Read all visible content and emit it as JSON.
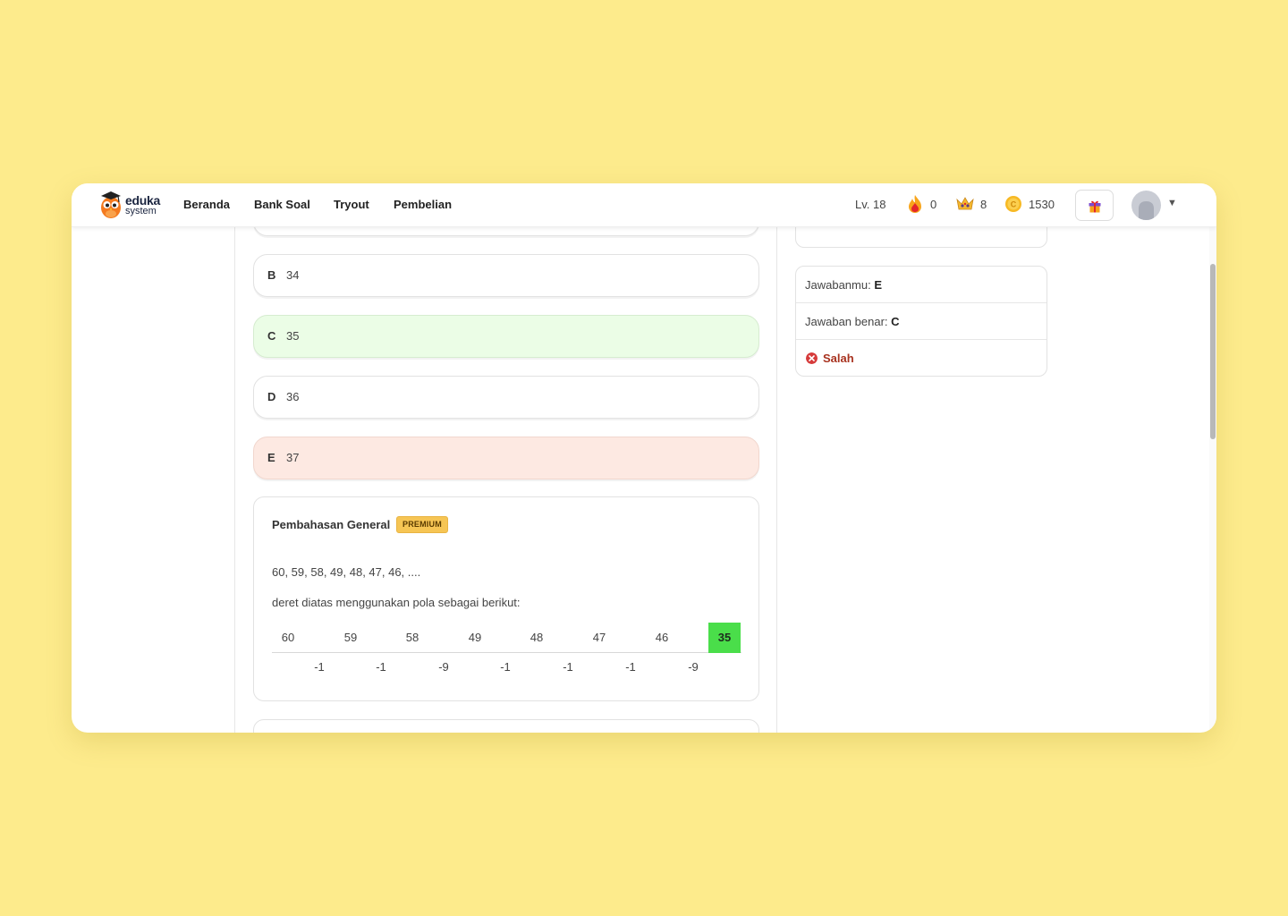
{
  "brand": {
    "name_line1": "eduka",
    "name_line2": "system"
  },
  "nav": {
    "links": [
      "Beranda",
      "Bank Soal",
      "Tryout",
      "Pembelian"
    ],
    "level": "Lv. 18",
    "streak": "0",
    "crowns": "8",
    "coins": "1530"
  },
  "options": [
    {
      "letter": "B",
      "value": "34",
      "state": "normal"
    },
    {
      "letter": "C",
      "value": "35",
      "state": "correct"
    },
    {
      "letter": "D",
      "value": "36",
      "state": "normal"
    },
    {
      "letter": "E",
      "value": "37",
      "state": "wrong"
    }
  ],
  "explanation": {
    "title": "Pembahasan General",
    "badge": "PREMIUM",
    "sequence_text": "60, 59, 58, 49, 48, 47, 46, ....",
    "pattern_text": "deret diatas menggunakan pola sebagai berikut:",
    "sequence": [
      "60",
      "59",
      "58",
      "49",
      "48",
      "47",
      "46",
      "35"
    ],
    "differences": [
      "-1",
      "-1",
      "-9",
      "-1",
      "-1",
      "-1",
      "-9"
    ]
  },
  "answer": {
    "yours_label": "Jawabanmu: ",
    "yours_value": "E",
    "correct_label": "Jawaban benar: ",
    "correct_value": "C",
    "status": "Salah"
  },
  "colors": {
    "background": "#fdeb8c",
    "correct_option": "#ebfde6",
    "wrong_option": "#fde9e2",
    "highlight": "#4ade4a",
    "badge": "#f6c554",
    "error": "#d63b3b"
  }
}
